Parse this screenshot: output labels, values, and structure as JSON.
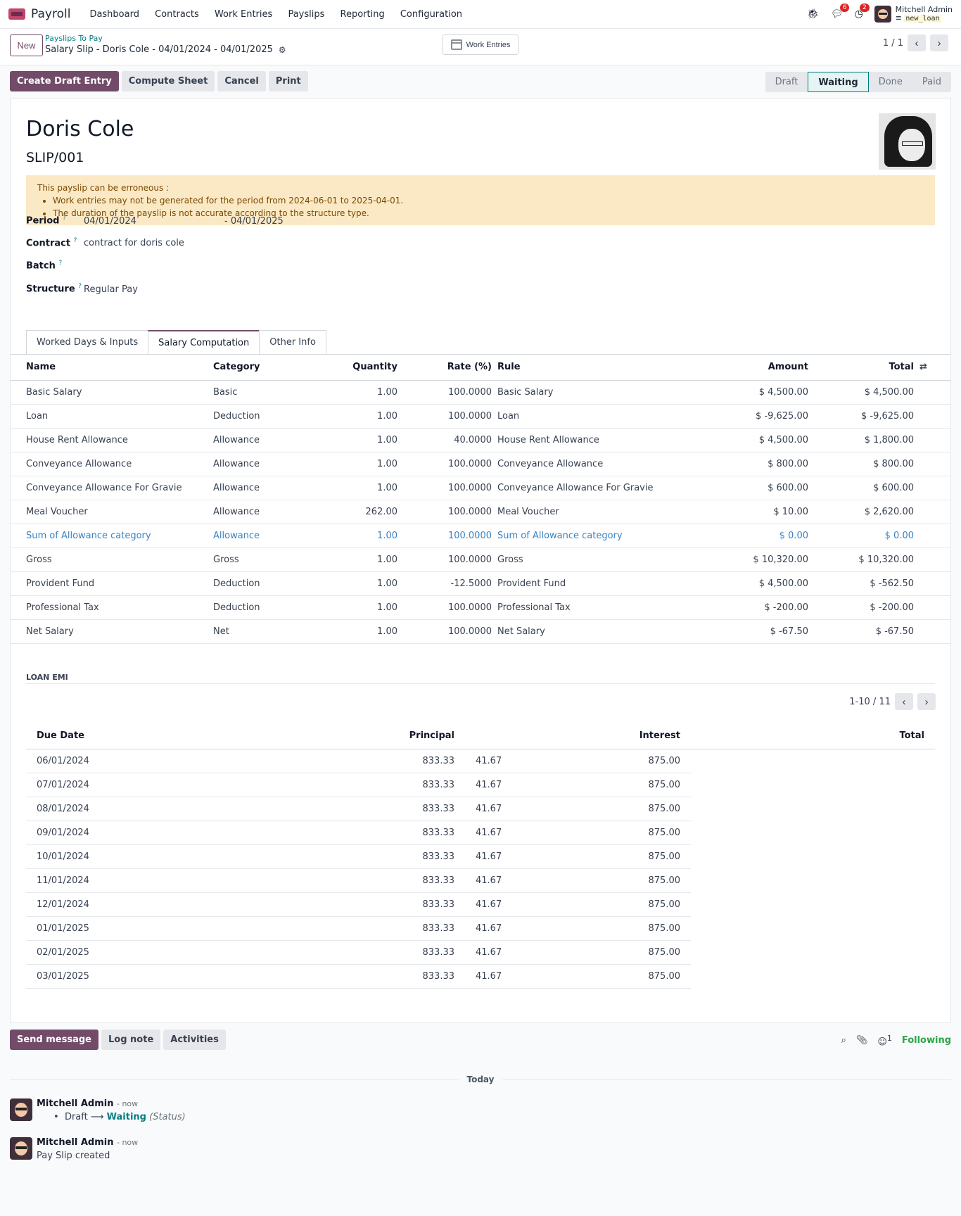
{
  "app": {
    "name": "Payroll",
    "menu": [
      "Dashboard",
      "Contracts",
      "Work Entries",
      "Payslips",
      "Reporting",
      "Configuration"
    ]
  },
  "systray": {
    "messages_count": "6",
    "activities_count": "2",
    "user_name": "Mitchell Admin",
    "database": "new_loan"
  },
  "control": {
    "new_label": "New",
    "breadcrumb": "Payslips To Pay",
    "record_title": "Salary Slip - Doris Cole - 04/01/2024 - 04/01/2025",
    "work_entries_label": "Work Entries",
    "pager": "1 / 1"
  },
  "actions": {
    "create_draft": "Create Draft Entry",
    "compute_sheet": "Compute Sheet",
    "cancel": "Cancel",
    "print": "Print"
  },
  "status": {
    "stages": [
      "Draft",
      "Waiting",
      "Done",
      "Paid"
    ],
    "active": "Waiting"
  },
  "form": {
    "employee": "Doris Cole",
    "reference": "SLIP/001",
    "alert": {
      "title": "This payslip can be erroneous :",
      "items": [
        "Work entries may not be generated for the period from 2024-06-01 to 2025-04-01.",
        "The duration of the payslip is not accurate according to the structure type."
      ]
    },
    "period_label": "Period",
    "period_from": "04/01/2024",
    "period_to": "- 04/01/2025",
    "contract_label": "Contract",
    "contract": "contract for doris cole",
    "batch_label": "Batch",
    "structure_label": "Structure",
    "structure": "Regular Pay",
    "help_mark": "?"
  },
  "tabs": [
    "Worked Days & Inputs",
    "Salary Computation",
    "Other Info"
  ],
  "salary": {
    "columns": [
      "Name",
      "Category",
      "Quantity",
      "Rate (%)",
      "Rule",
      "Amount",
      "Total"
    ],
    "rows": [
      [
        "Basic Salary",
        "Basic",
        "1.00",
        "100.0000",
        "Basic Salary",
        "$ 4,500.00",
        "$ 4,500.00"
      ],
      [
        "Loan",
        "Deduction",
        "1.00",
        "100.0000",
        "Loan",
        "$ -9,625.00",
        "$ -9,625.00"
      ],
      [
        "House Rent Allowance",
        "Allowance",
        "1.00",
        "40.0000",
        "House Rent Allowance",
        "$ 4,500.00",
        "$ 1,800.00"
      ],
      [
        "Conveyance Allowance",
        "Allowance",
        "1.00",
        "100.0000",
        "Conveyance Allowance",
        "$ 800.00",
        "$ 800.00"
      ],
      [
        "Conveyance Allowance For Gravie",
        "Allowance",
        "1.00",
        "100.0000",
        "Conveyance Allowance For Gravie",
        "$ 600.00",
        "$ 600.00"
      ],
      [
        "Meal Voucher",
        "Allowance",
        "262.00",
        "100.0000",
        "Meal Voucher",
        "$ 10.00",
        "$ 2,620.00"
      ],
      [
        "Sum of Allowance category",
        "Allowance",
        "1.00",
        "100.0000",
        "Sum of Allowance category",
        "$ 0.00",
        "$ 0.00"
      ],
      [
        "Gross",
        "Gross",
        "1.00",
        "100.0000",
        "Gross",
        "$ 10,320.00",
        "$ 10,320.00"
      ],
      [
        "Provident Fund",
        "Deduction",
        "1.00",
        "-12.5000",
        "Provident Fund",
        "$ 4,500.00",
        "$ -562.50"
      ],
      [
        "Professional Tax",
        "Deduction",
        "1.00",
        "100.0000",
        "Professional Tax",
        "$ -200.00",
        "$ -200.00"
      ],
      [
        "Net Salary",
        "Net",
        "1.00",
        "100.0000",
        "Net Salary",
        "$ -67.50",
        "$ -67.50"
      ]
    ]
  },
  "loan": {
    "title": "LOAN EMI",
    "pager": "1-10 / 11",
    "columns": [
      "Due Date",
      "Principal",
      "Interest",
      "Total"
    ],
    "rows": [
      [
        "06/01/2024",
        "833.33",
        "41.67",
        "875.00"
      ],
      [
        "07/01/2024",
        "833.33",
        "41.67",
        "875.00"
      ],
      [
        "08/01/2024",
        "833.33",
        "41.67",
        "875.00"
      ],
      [
        "09/01/2024",
        "833.33",
        "41.67",
        "875.00"
      ],
      [
        "10/01/2024",
        "833.33",
        "41.67",
        "875.00"
      ],
      [
        "11/01/2024",
        "833.33",
        "41.67",
        "875.00"
      ],
      [
        "12/01/2024",
        "833.33",
        "41.67",
        "875.00"
      ],
      [
        "01/01/2025",
        "833.33",
        "41.67",
        "875.00"
      ],
      [
        "02/01/2025",
        "833.33",
        "41.67",
        "875.00"
      ],
      [
        "03/01/2025",
        "833.33",
        "41.67",
        "875.00"
      ]
    ]
  },
  "chatter": {
    "send": "Send message",
    "log": "Log note",
    "activities": "Activities",
    "followers_count": "1",
    "following": "Following",
    "today": "Today",
    "messages": [
      {
        "author": "Mitchell Admin",
        "time": "- now",
        "from": "Draft",
        "to": "Waiting",
        "field": "(Status)"
      },
      {
        "author": "Mitchell Admin",
        "time": "- now",
        "body": "Pay Slip created"
      }
    ]
  },
  "colors": {
    "brand": "#714b67",
    "accent": "#017e84",
    "alert_bg": "#fbe9c5",
    "highlight_row": "#3b82c4",
    "following": "#28a745"
  }
}
